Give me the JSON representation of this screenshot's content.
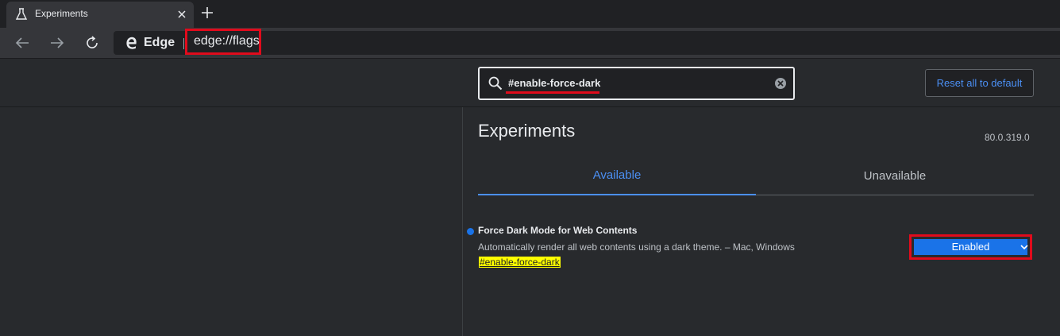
{
  "browser": {
    "tab_title": "Experiments",
    "new_tab_symbol": "+",
    "brand_label": "Edge",
    "url": "edge://flags"
  },
  "toolbar": {
    "back_icon": "back-arrow-icon",
    "forward_icon": "forward-arrow-icon",
    "refresh_icon": "refresh-icon"
  },
  "search": {
    "value": "#enable-force-dark",
    "clear_icon": "clear-icon"
  },
  "reset_button_label": "Reset all to default",
  "page": {
    "title": "Experiments",
    "version": "80.0.319.0",
    "tabs": [
      {
        "label": "Available",
        "active": true
      },
      {
        "label": "Unavailable",
        "active": false
      }
    ]
  },
  "flag": {
    "name": "Force Dark Mode for Web Contents",
    "description": "Automatically render all web contents using a dark theme. – Mac, Windows",
    "tag": "#enable-force-dark",
    "selected_option": "Enabled"
  },
  "colors": {
    "accent": "#4b8ff3",
    "select_bg": "#1a73e8",
    "highlight_annotation": "#e00b1c",
    "tag_highlight": "#ffff00",
    "background": "#282a2d"
  }
}
